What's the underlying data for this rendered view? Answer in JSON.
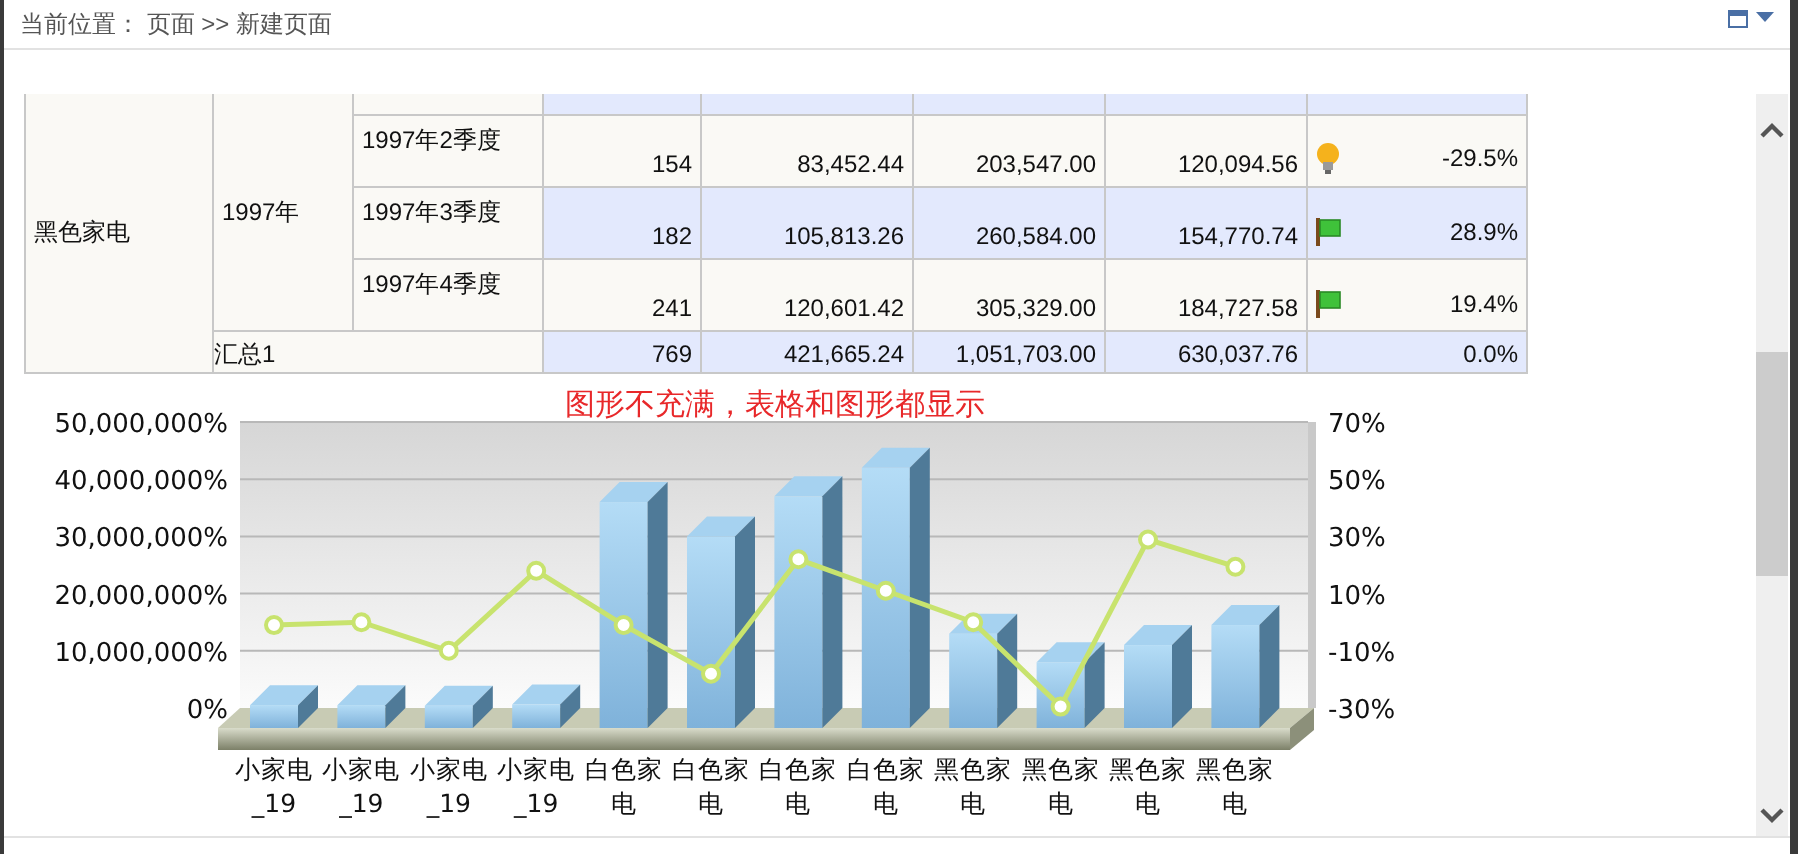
{
  "breadcrumb": "当前位置： 页面 >> 新建页面",
  "table": {
    "group": "黑色家电",
    "year": "1997年",
    "rows": [
      {
        "quarter": "1997年2季度",
        "values": [
          "154",
          "83,452.44",
          "203,547.00",
          "120,094.56"
        ],
        "kind": "bulb",
        "change": "-29.5%"
      },
      {
        "quarter": "1997年3季度",
        "values": [
          "182",
          "105,813.26",
          "260,584.00",
          "154,770.74"
        ],
        "kind": "flag",
        "change": "28.9%"
      },
      {
        "quarter": "1997年4季度",
        "values": [
          "241",
          "120,601.42",
          "305,329.00",
          "184,727.58"
        ],
        "kind": "flag",
        "change": "19.4%"
      }
    ],
    "total": {
      "label": "汇总1",
      "values": [
        "769",
        "421,665.24",
        "1,051,703.00",
        "630,037.76"
      ],
      "change": "0.0%"
    }
  },
  "chart_title": "图形不充满，表格和图形都显示",
  "chart_data": {
    "type": "bar",
    "grid": true,
    "categories": [
      "小家电_19",
      "小家电_19",
      "小家电_19",
      "小家电_19",
      "白色家电",
      "白色家电",
      "白色家电",
      "白色家电",
      "黑色家电",
      "黑色家电",
      "黑色家电",
      "黑色家电"
    ],
    "series": [
      {
        "color": "#7fb2da",
        "values": [
          500000,
          500000,
          400000,
          600000,
          36000000,
          30000000,
          37000000,
          42000000,
          13000000,
          8000000,
          11000000,
          14500000
        ]
      }
    ],
    "ylim": [
      0,
      50000000
    ],
    "yticks": [
      {
        "value": 0,
        "label": "0%"
      },
      {
        "value": 10000000,
        "label": "10,000,000%"
      },
      {
        "value": 20000000,
        "label": "20,000,000%"
      },
      {
        "value": 30000000,
        "label": "30,000,000%"
      },
      {
        "value": 40000000,
        "label": "40,000,000%"
      },
      {
        "value": 50000000,
        "label": "50,000,000%"
      }
    ]
  },
  "line_chart": {
    "chart_data": {
      "type": "line",
      "series": [
        {
          "color": "#c8e36e",
          "marker": "o",
          "values": [
            -1,
            0,
            -10,
            18,
            -1,
            -18,
            22,
            11,
            0,
            -29.5,
            28.9,
            19.4
          ]
        }
      ],
      "ylim": [
        -30,
        70
      ],
      "yticks": [
        {
          "value": -30,
          "label": "-30%"
        },
        {
          "value": -10,
          "label": "-10%"
        },
        {
          "value": 10,
          "label": "10%"
        },
        {
          "value": 30,
          "label": "30%"
        },
        {
          "value": 50,
          "label": "50%"
        },
        {
          "value": 70,
          "label": "70%"
        }
      ]
    }
  }
}
